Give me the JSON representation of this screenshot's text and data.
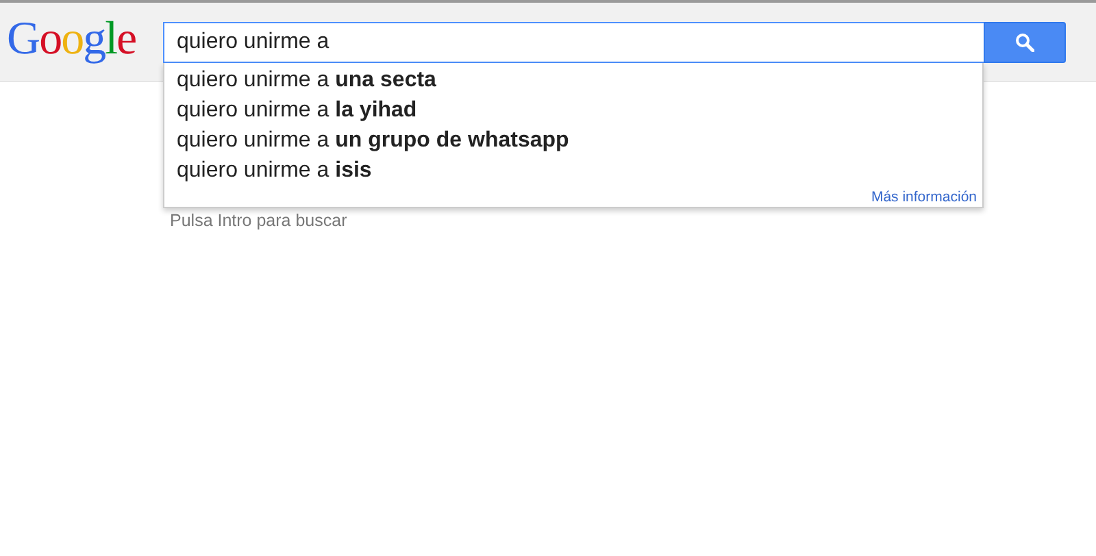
{
  "logo": "Google",
  "search": {
    "value": "quiero unirme a"
  },
  "suggestions": [
    "quiero unirme a **una secta**",
    "quiero unirme a **la yihad**",
    "quiero unirme a **un grupo de whatsapp**",
    "quiero unirme a **isis**"
  ],
  "more_info_link": "Más información",
  "hint": "Pulsa Intro para buscar"
}
